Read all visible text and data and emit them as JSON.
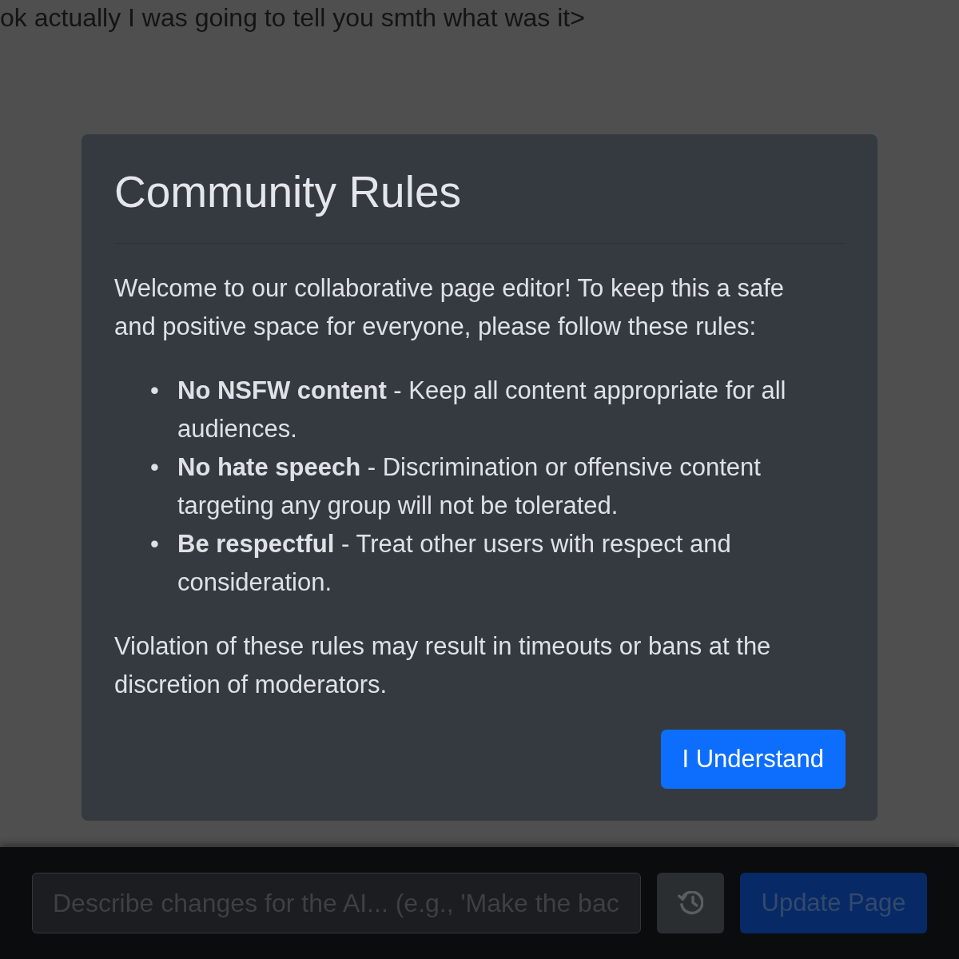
{
  "page": {
    "message": "ok actually I was going to tell you smth what was it>"
  },
  "modal": {
    "title": "Community Rules",
    "intro": "Welcome to our collaborative page editor! To keep this a safe and positive space for everyone, please follow these rules:",
    "rules": [
      {
        "marker": "•",
        "text": "**No NSFW content** - Keep all content appropriate for all audiences."
      },
      {
        "marker": "•",
        "text": "**No hate speech** - Discrimination or offensive content targeting any group will not be tolerated."
      },
      {
        "marker": "•",
        "text": "**Be respectful** - Treat other users with respect and consideration."
      }
    ],
    "closing": "Violation of these rules may result in timeouts or bans at the discretion of moderators.",
    "button": "I Understand"
  },
  "bottom_bar": {
    "prompt": {
      "placeholder": "Describe changes for the AI... (e.g., 'Make the bac"
    },
    "update_button": "Update Page"
  }
}
